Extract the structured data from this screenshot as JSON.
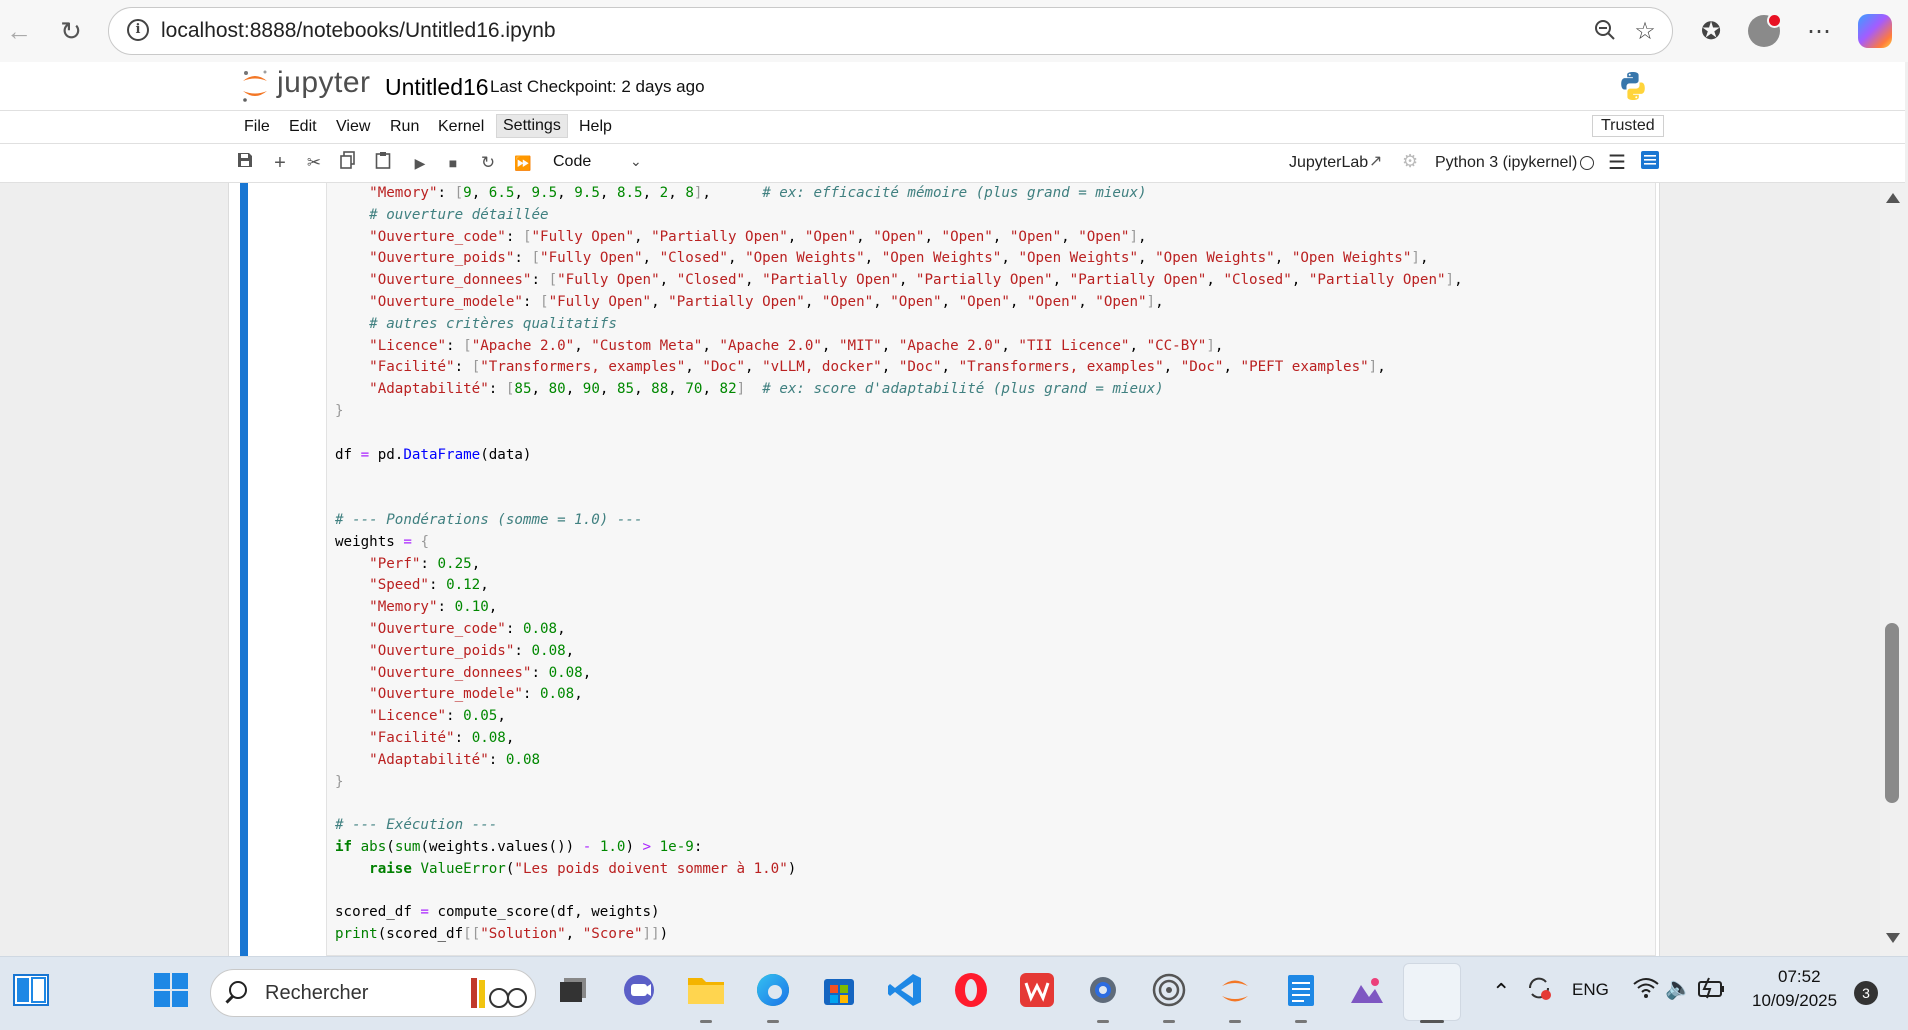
{
  "browser": {
    "url": "localhost:8888/notebooks/Untitled16.ipynb"
  },
  "jupyter": {
    "logo_text": "jupyter",
    "notebook_title": "Untitled16",
    "checkpoint": "Last Checkpoint: 2 days ago",
    "trusted": "Trusted",
    "menu": [
      "File",
      "Edit",
      "View",
      "Run",
      "Kernel",
      "Settings",
      "Help"
    ],
    "active_menu": "Settings",
    "cell_type": "Code",
    "jupyterlab_link": "JupyterLab",
    "kernel": "Python 3 (ipykernel)"
  },
  "code_lines": [
    "    \"Memory\": [9, 6.5, 9.5, 9.5, 8.5, 2, 8],      # ex: efficacité mémoire (plus grand = mieux)",
    "    # ouverture détaillée",
    "    \"Ouverture_code\": [\"Fully Open\", \"Partially Open\", \"Open\", \"Open\", \"Open\", \"Open\", \"Open\"],",
    "    \"Ouverture_poids\": [\"Fully Open\", \"Closed\", \"Open Weights\", \"Open Weights\", \"Open Weights\", \"Open Weights\", \"Open Weights\"],",
    "    \"Ouverture_donnees\": [\"Fully Open\", \"Closed\", \"Partially Open\", \"Partially Open\", \"Partially Open\", \"Closed\", \"Partially Open\"],",
    "    \"Ouverture_modele\": [\"Fully Open\", \"Partially Open\", \"Open\", \"Open\", \"Open\", \"Open\", \"Open\"],",
    "    # autres critères qualitatifs",
    "    \"Licence\": [\"Apache 2.0\", \"Custom Meta\", \"Apache 2.0\", \"MIT\", \"Apache 2.0\", \"TII Licence\", \"CC-BY\"],",
    "    \"Facilité\": [\"Transformers, examples\", \"Doc\", \"vLLM, docker\", \"Doc\", \"Transformers, examples\", \"Doc\", \"PEFT examples\"],",
    "    \"Adaptabilité\": [85, 80, 90, 85, 88, 70, 82]  # ex: score d'adaptabilité (plus grand = mieux)",
    "}",
    "",
    "df = pd.DataFrame(data)",
    "",
    "",
    "# --- Pondérations (somme = 1.0) ---",
    "weights = {",
    "    \"Perf\": 0.25,",
    "    \"Speed\": 0.12,",
    "    \"Memory\": 0.10,",
    "    \"Ouverture_code\": 0.08,",
    "    \"Ouverture_poids\": 0.08,",
    "    \"Ouverture_donnees\": 0.08,",
    "    \"Ouverture_modele\": 0.08,",
    "    \"Licence\": 0.05,",
    "    \"Facilité\": 0.08,",
    "    \"Adaptabilité\": 0.08",
    "}",
    "",
    "# --- Exécution ---",
    "if abs(sum(weights.values()) - 1.0) > 1e-9:",
    "    raise ValueError(\"Les poids doivent sommer à 1.0\")",
    "",
    "scored_df = compute_score(df, weights)",
    "print(scored_df[[\"Solution\", \"Score\"]])"
  ],
  "taskbar": {
    "search_placeholder": "Rechercher",
    "language": "ENG",
    "time": "07:52",
    "date": "10/09/2025",
    "notifications": "3"
  }
}
